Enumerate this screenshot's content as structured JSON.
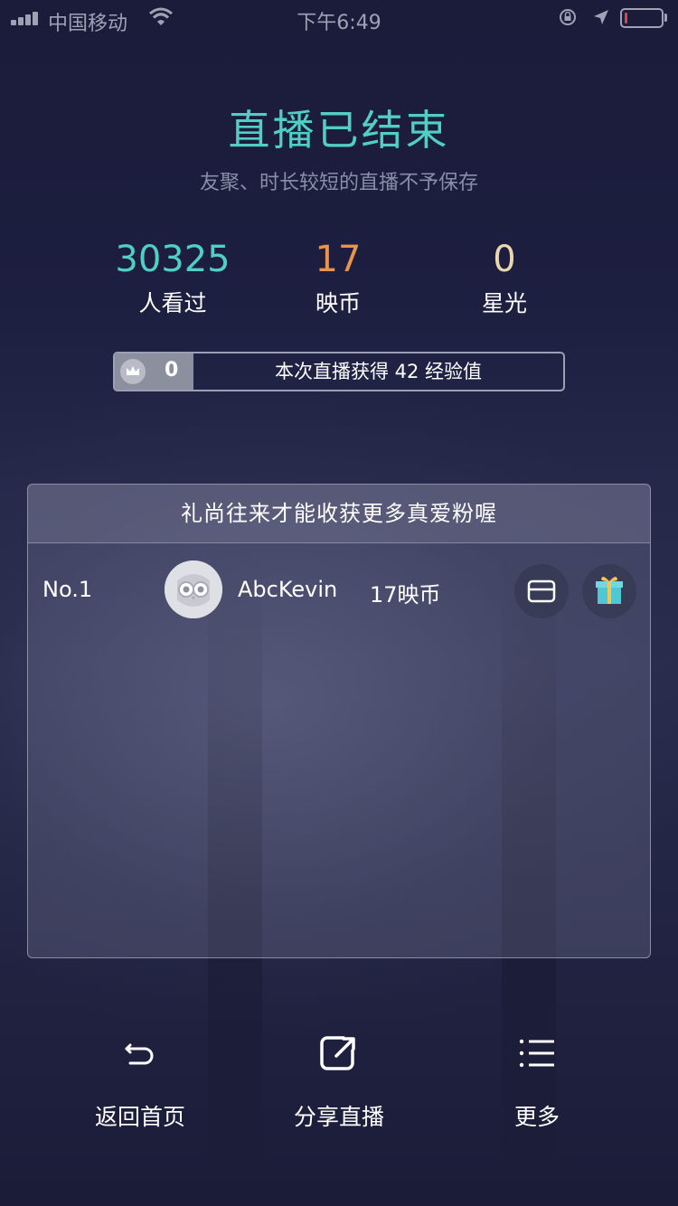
{
  "status_bar": {
    "carrier": "中国移动",
    "time": "下午6:49"
  },
  "header": {
    "title": "直播已结束",
    "subtitle": "友聚、时长较短的直播不予保存"
  },
  "stats": [
    {
      "value": "30325",
      "label": "人看过",
      "color": "#4fd0c2"
    },
    {
      "value": "17",
      "label": "映币",
      "color": "#e8944a"
    },
    {
      "value": "0",
      "label": "星光",
      "color": "#e9d7b0"
    }
  ],
  "experience": {
    "level": "0",
    "text": "本次直播获得 42 经验值"
  },
  "fans_panel": {
    "title": "礼尚往来才能收获更多真爱粉喔",
    "rows": [
      {
        "rank": "No.1",
        "name": "AbcKevin",
        "coins": "17映币"
      }
    ]
  },
  "bottom_nav": [
    {
      "label": "返回首页",
      "icon": "return-icon"
    },
    {
      "label": "分享直播",
      "icon": "share-icon"
    },
    {
      "label": "更多",
      "icon": "list-icon"
    }
  ]
}
